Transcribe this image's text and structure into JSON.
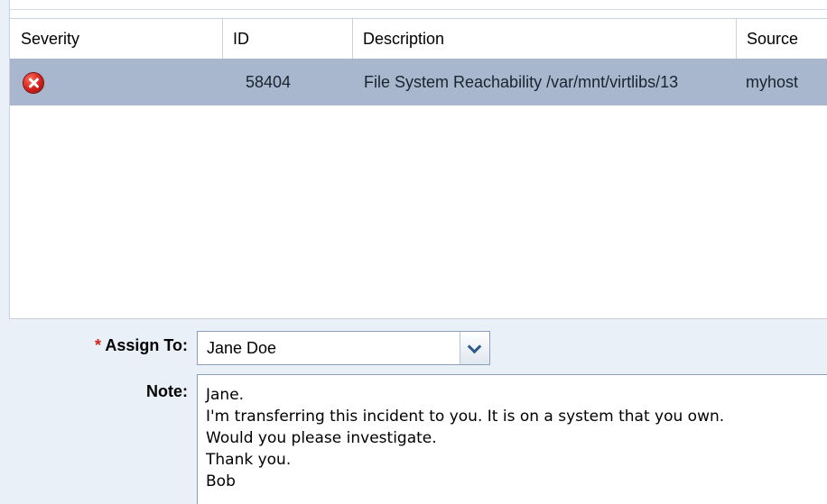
{
  "table": {
    "columns": [
      "Severity",
      "ID",
      "Description",
      "Source"
    ],
    "rows": [
      {
        "severity_icon": "error-icon",
        "id": "58404",
        "description": "File System Reachability /var/mnt/virtlibs/13",
        "source": "myhost"
      }
    ]
  },
  "form": {
    "required_marker": "*",
    "assign_label": "Assign To:",
    "assign_value": "Jane Doe",
    "note_label": "Note:",
    "note_text": "Jane.\nI'm transferring this incident to you. It is on a system that you own.\nWould you please investigate.\nThank you.\nBob"
  },
  "colors": {
    "selected_row": "#a8b7cd",
    "form_background": "#eaf0f7",
    "required": "#d21f1f"
  }
}
